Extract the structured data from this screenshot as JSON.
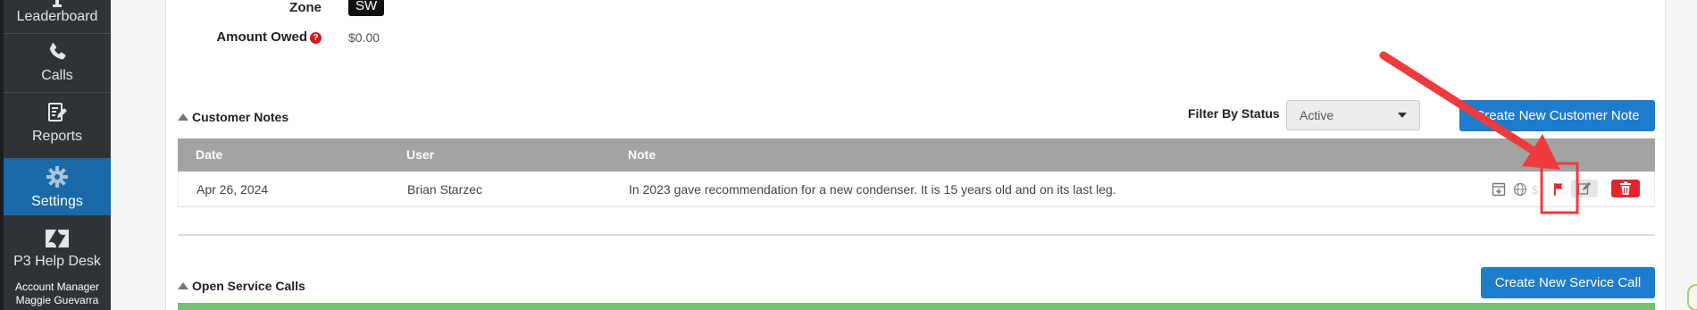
{
  "sidebar": {
    "items": [
      {
        "label": "Leaderboard",
        "icon": "trophy-icon"
      },
      {
        "label": "Calls",
        "icon": "phone-icon"
      },
      {
        "label": "Reports",
        "icon": "report-edit-icon"
      },
      {
        "label": "Settings",
        "icon": "gear-icon",
        "active": true
      },
      {
        "label": "P3 Help Desk",
        "icon": "zendesk-icon"
      }
    ],
    "account_role": "Account Manager",
    "account_name": "Maggie Guevarra"
  },
  "customer_info": {
    "zone_label": "Zone",
    "zone_value": "SW",
    "amount_owed_label": "Amount Owed",
    "amount_owed_value": "$0.00"
  },
  "customer_notes": {
    "title": "Customer Notes",
    "filter_label": "Filter By Status",
    "filter_value": "Active",
    "create_button": "Create New Customer Note",
    "columns": [
      "Date",
      "User",
      "Note"
    ],
    "rows": [
      {
        "date": "Apr 26, 2024",
        "user": "Brian Starzec",
        "note": "In 2023 gave recommendation for a new condenser. It is 15 years old and on its last leg."
      }
    ],
    "row_actions": [
      "archive-icon",
      "globe-icon",
      "dollar-icon",
      "flag-icon",
      "edit-icon",
      "trash-icon"
    ]
  },
  "open_service_calls": {
    "title": "Open Service Calls",
    "create_button": "Create New Service Call"
  },
  "colors": {
    "sidebar_bg": "#2f3338",
    "active_nav": "#1a69a8",
    "primary_button": "#1e7ccc",
    "table_header": "#a3a3a3",
    "delete_button": "#e8232a",
    "annotation": "#ef3b3e",
    "status_bar": "#72c473"
  }
}
